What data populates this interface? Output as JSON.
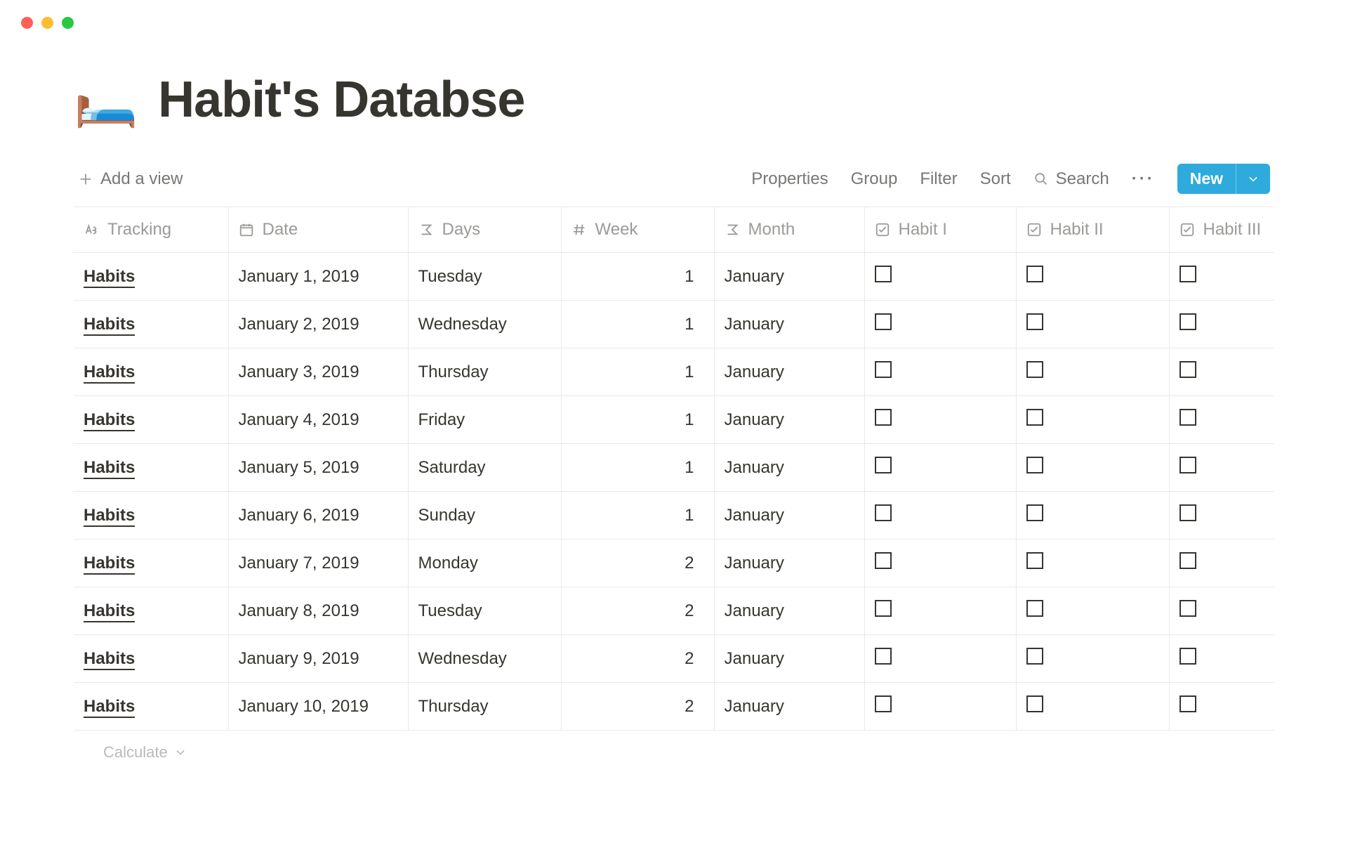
{
  "window": {
    "controls": [
      "close",
      "minimize",
      "zoom"
    ]
  },
  "page": {
    "icon": "🛏️",
    "title": "Habit's Databse"
  },
  "toolbar": {
    "add_view_label": "Add a view",
    "properties_label": "Properties",
    "group_label": "Group",
    "filter_label": "Filter",
    "sort_label": "Sort",
    "search_label": "Search",
    "more_label": "···",
    "new_label": "New"
  },
  "table": {
    "columns": [
      {
        "key": "tracking",
        "label": "Tracking",
        "type": "title"
      },
      {
        "key": "date",
        "label": "Date",
        "type": "date"
      },
      {
        "key": "days",
        "label": "Days",
        "type": "formula"
      },
      {
        "key": "week",
        "label": "Week",
        "type": "number"
      },
      {
        "key": "month",
        "label": "Month",
        "type": "formula"
      },
      {
        "key": "habit1",
        "label": "Habit I",
        "type": "checkbox"
      },
      {
        "key": "habit2",
        "label": "Habit II",
        "type": "checkbox"
      },
      {
        "key": "habit3",
        "label": "Habit III",
        "type": "checkbox"
      }
    ],
    "rows": [
      {
        "tracking": "Habits",
        "date": "January 1, 2019",
        "days": "Tuesday",
        "week": "1",
        "month": "January",
        "habit1": false,
        "habit2": false,
        "habit3": false
      },
      {
        "tracking": "Habits",
        "date": "January 2, 2019",
        "days": "Wednesday",
        "week": "1",
        "month": "January",
        "habit1": false,
        "habit2": false,
        "habit3": false
      },
      {
        "tracking": "Habits",
        "date": "January 3, 2019",
        "days": "Thursday",
        "week": "1",
        "month": "January",
        "habit1": false,
        "habit2": false,
        "habit3": false
      },
      {
        "tracking": "Habits",
        "date": "January 4, 2019",
        "days": "Friday",
        "week": "1",
        "month": "January",
        "habit1": false,
        "habit2": false,
        "habit3": false
      },
      {
        "tracking": "Habits",
        "date": "January 5, 2019",
        "days": "Saturday",
        "week": "1",
        "month": "January",
        "habit1": false,
        "habit2": false,
        "habit3": false
      },
      {
        "tracking": "Habits",
        "date": "January 6, 2019",
        "days": "Sunday",
        "week": "1",
        "month": "January",
        "habit1": false,
        "habit2": false,
        "habit3": false
      },
      {
        "tracking": "Habits",
        "date": "January 7, 2019",
        "days": "Monday",
        "week": "2",
        "month": "January",
        "habit1": false,
        "habit2": false,
        "habit3": false
      },
      {
        "tracking": "Habits",
        "date": "January 8, 2019",
        "days": "Tuesday",
        "week": "2",
        "month": "January",
        "habit1": false,
        "habit2": false,
        "habit3": false
      },
      {
        "tracking": "Habits",
        "date": "January 9, 2019",
        "days": "Wednesday",
        "week": "2",
        "month": "January",
        "habit1": false,
        "habit2": false,
        "habit3": false
      },
      {
        "tracking": "Habits",
        "date": "January 10, 2019",
        "days": "Thursday",
        "week": "2",
        "month": "January",
        "habit1": false,
        "habit2": false,
        "habit3": false
      }
    ],
    "calculate_label": "Calculate"
  }
}
